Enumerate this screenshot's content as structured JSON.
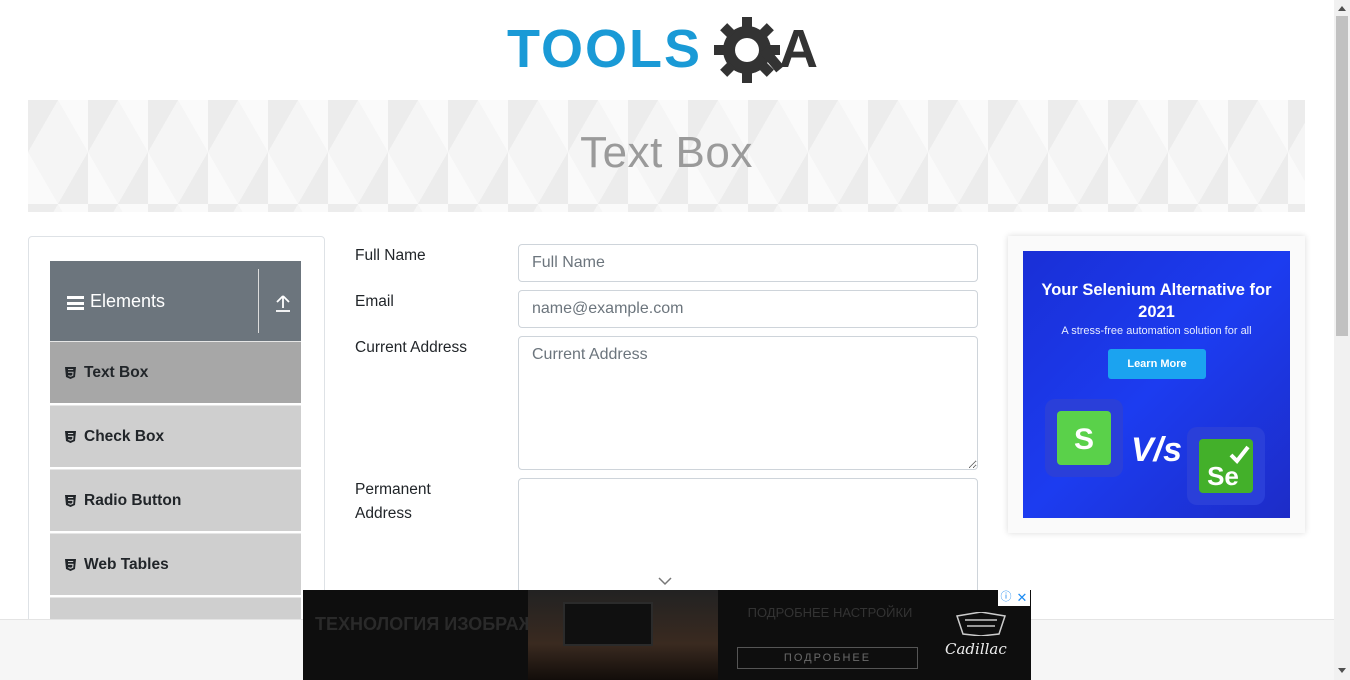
{
  "logo": {
    "text_main": "TOOLS",
    "text_q": "Q",
    "text_a": "A"
  },
  "banner": {
    "title": "Text Box"
  },
  "sidebar": {
    "group_title": "Elements",
    "items": [
      {
        "label": "Text Box",
        "active": true
      },
      {
        "label": "Check Box",
        "active": false
      },
      {
        "label": "Radio Button",
        "active": false
      },
      {
        "label": "Web Tables",
        "active": false
      },
      {
        "label": "",
        "active": false
      }
    ]
  },
  "form": {
    "full_name": {
      "label": "Full Name",
      "placeholder": "Full Name",
      "value": ""
    },
    "email": {
      "label": "Email",
      "placeholder": "name@example.com",
      "value": ""
    },
    "current_address": {
      "label": "Current Address",
      "placeholder": "Current Address",
      "value": ""
    },
    "permanent_address": {
      "label": "Permanent Address",
      "placeholder": "",
      "value": ""
    }
  },
  "ad_side": {
    "headline": "Your Selenium Alternative for 2021",
    "subline": "A stress-free automation solution for all",
    "button": "Learn More",
    "vs": "V/s",
    "logo_left": "S",
    "logo_right": "Se"
  },
  "ad_bottom": {
    "text_left": "ТЕХНОЛОГИЯ ИЗОБРАЖЕНИЯ",
    "text_mid": "ПОДРОБНЕЕ НАСТРОЙКИ",
    "cta": "ПОДРОБНЕЕ",
    "brand": "Cadillac",
    "info_icon": "ⓘ",
    "close_icon": "✕"
  },
  "colors": {
    "logo_blue": "#1a9ad6",
    "logo_dark": "#333333",
    "sidebar_header": "#6c757d",
    "active_item": "#a7a7a7",
    "item_bg": "#cfcfcf",
    "ad_blue": "#1c3cf0"
  }
}
